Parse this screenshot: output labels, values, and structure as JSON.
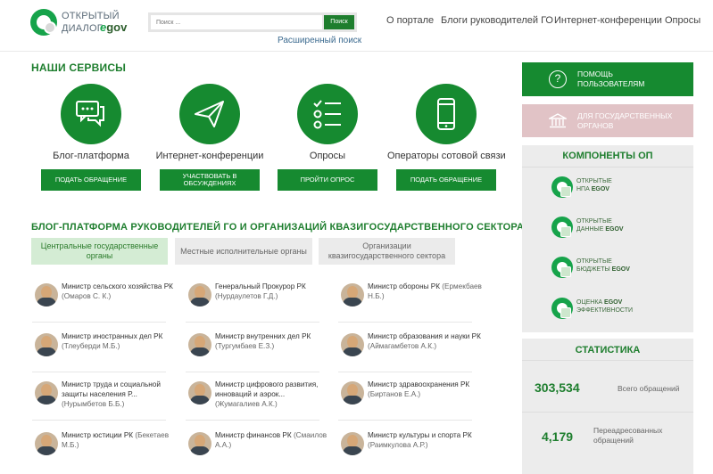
{
  "header": {
    "logo_line1": "ОТКРЫТЫЙ",
    "logo_line2": "ДИАЛОГ",
    "logo_gov_e": "e",
    "logo_gov_text": "gov",
    "search_placeholder": "Поиск ...",
    "search_button": "Поиск",
    "advanced_search": "Расширенный поиск",
    "nav": [
      "О портале",
      "Блоги руководителей ГО",
      "Интернет-конференции",
      "Опросы"
    ]
  },
  "services": {
    "title": "НАШИ СЕРВИСЫ",
    "items": [
      {
        "name": "Блог-платформа",
        "button": "ПОДАТЬ ОБРАЩЕНИЕ",
        "icon": "chat-icon"
      },
      {
        "name": "Интернет-конференции",
        "button": "УЧАСТВОВАТЬ В ОБСУЖДЕНИЯХ",
        "icon": "paper-plane-icon"
      },
      {
        "name": "Опросы",
        "button": "ПРОЙТИ ОПРОС",
        "icon": "checklist-icon"
      },
      {
        "name": "Операторы сотовой связи",
        "button": "ПОДАТЬ ОБРАЩЕНИЕ",
        "icon": "smartphone-icon"
      }
    ]
  },
  "blog": {
    "title": "БЛОГ-ПЛАТФОРМА РУКОВОДИТЕЛЕЙ ГО И ОРГАНИЗАЦИЙ КВАЗИГОСУДАРСТВЕННОГО СЕКТОРА",
    "tabs": [
      "Центральные государственные органы",
      "Местные исполнительные органы",
      "Организации квазигосударственного сектора"
    ],
    "ministers": [
      {
        "title": "Министр сельского хозяйства РК",
        "name": "(Омаров С. К.)"
      },
      {
        "title": "Генеральный Прокурор РК",
        "name": "(Нурдаулетов Г.Д.)"
      },
      {
        "title": "Министр обороны РК",
        "name": "(Ермекбаев Н.Б.)"
      },
      {
        "title": "Министр иностранных дел РК",
        "name": "(Тлеуберди М.Б.)"
      },
      {
        "title": "Министр внутренних дел РК",
        "name": "(Тургумбаев Е.З.)"
      },
      {
        "title": "Министр образования и науки РК",
        "name": "(Аймагамбетов А.К.)"
      },
      {
        "title": "Министр труда и социальной защиты населения Р...",
        "name": "(Нурымбетов Б.Б.)"
      },
      {
        "title": "Министр цифрового развития, инноваций и аэрок...",
        "name": "(Жумагалиев А.К.)"
      },
      {
        "title": "Министр здравоохранения РК",
        "name": "(Биртанов Е.А.)"
      },
      {
        "title": "Министр юстиции РК",
        "name": "(Бекетаев М.Б.)"
      },
      {
        "title": "Министр финансов РК",
        "name": "(Смаилов А.А.)"
      },
      {
        "title": "Министр культуры и спорта РК",
        "name": "(Раимкулова А.Р.)"
      }
    ]
  },
  "sidebar": {
    "help_line1": "ПОМОЩЬ",
    "help_line2": "ПОЛЬЗОВАТЕЛЯМ",
    "gov_line1": "ДЛЯ ГОСУДАРСТВЕННЫХ",
    "gov_line2": "ОРГАНОВ",
    "components_title": "КОМПОНЕНТЫ ОП",
    "components": [
      {
        "line1": "ОТКРЫТЫЕ",
        "line2": "НПА",
        "gov": "egov"
      },
      {
        "line1": "ОТКРЫТЫЕ",
        "line2": "ДАННЫЕ",
        "gov": "egov"
      },
      {
        "line1": "ОТКРЫТЫЕ",
        "line2": "БЮДЖЕТЫ",
        "gov": "egov"
      },
      {
        "line1": "ОЦЕНКА",
        "line2": "ЭФФЕКТИВНОСТИ",
        "gov": "egov"
      }
    ],
    "stats_title": "СТАТИСТИКА",
    "stats": [
      {
        "value": "303,534",
        "label": "Всего обращений"
      },
      {
        "value": "4,179",
        "label": "Переадресованных обращений"
      }
    ]
  },
  "colors": {
    "primary": "#168a30",
    "accent_light": "#d4ecd4",
    "gov_button": "#e1c3c6"
  }
}
